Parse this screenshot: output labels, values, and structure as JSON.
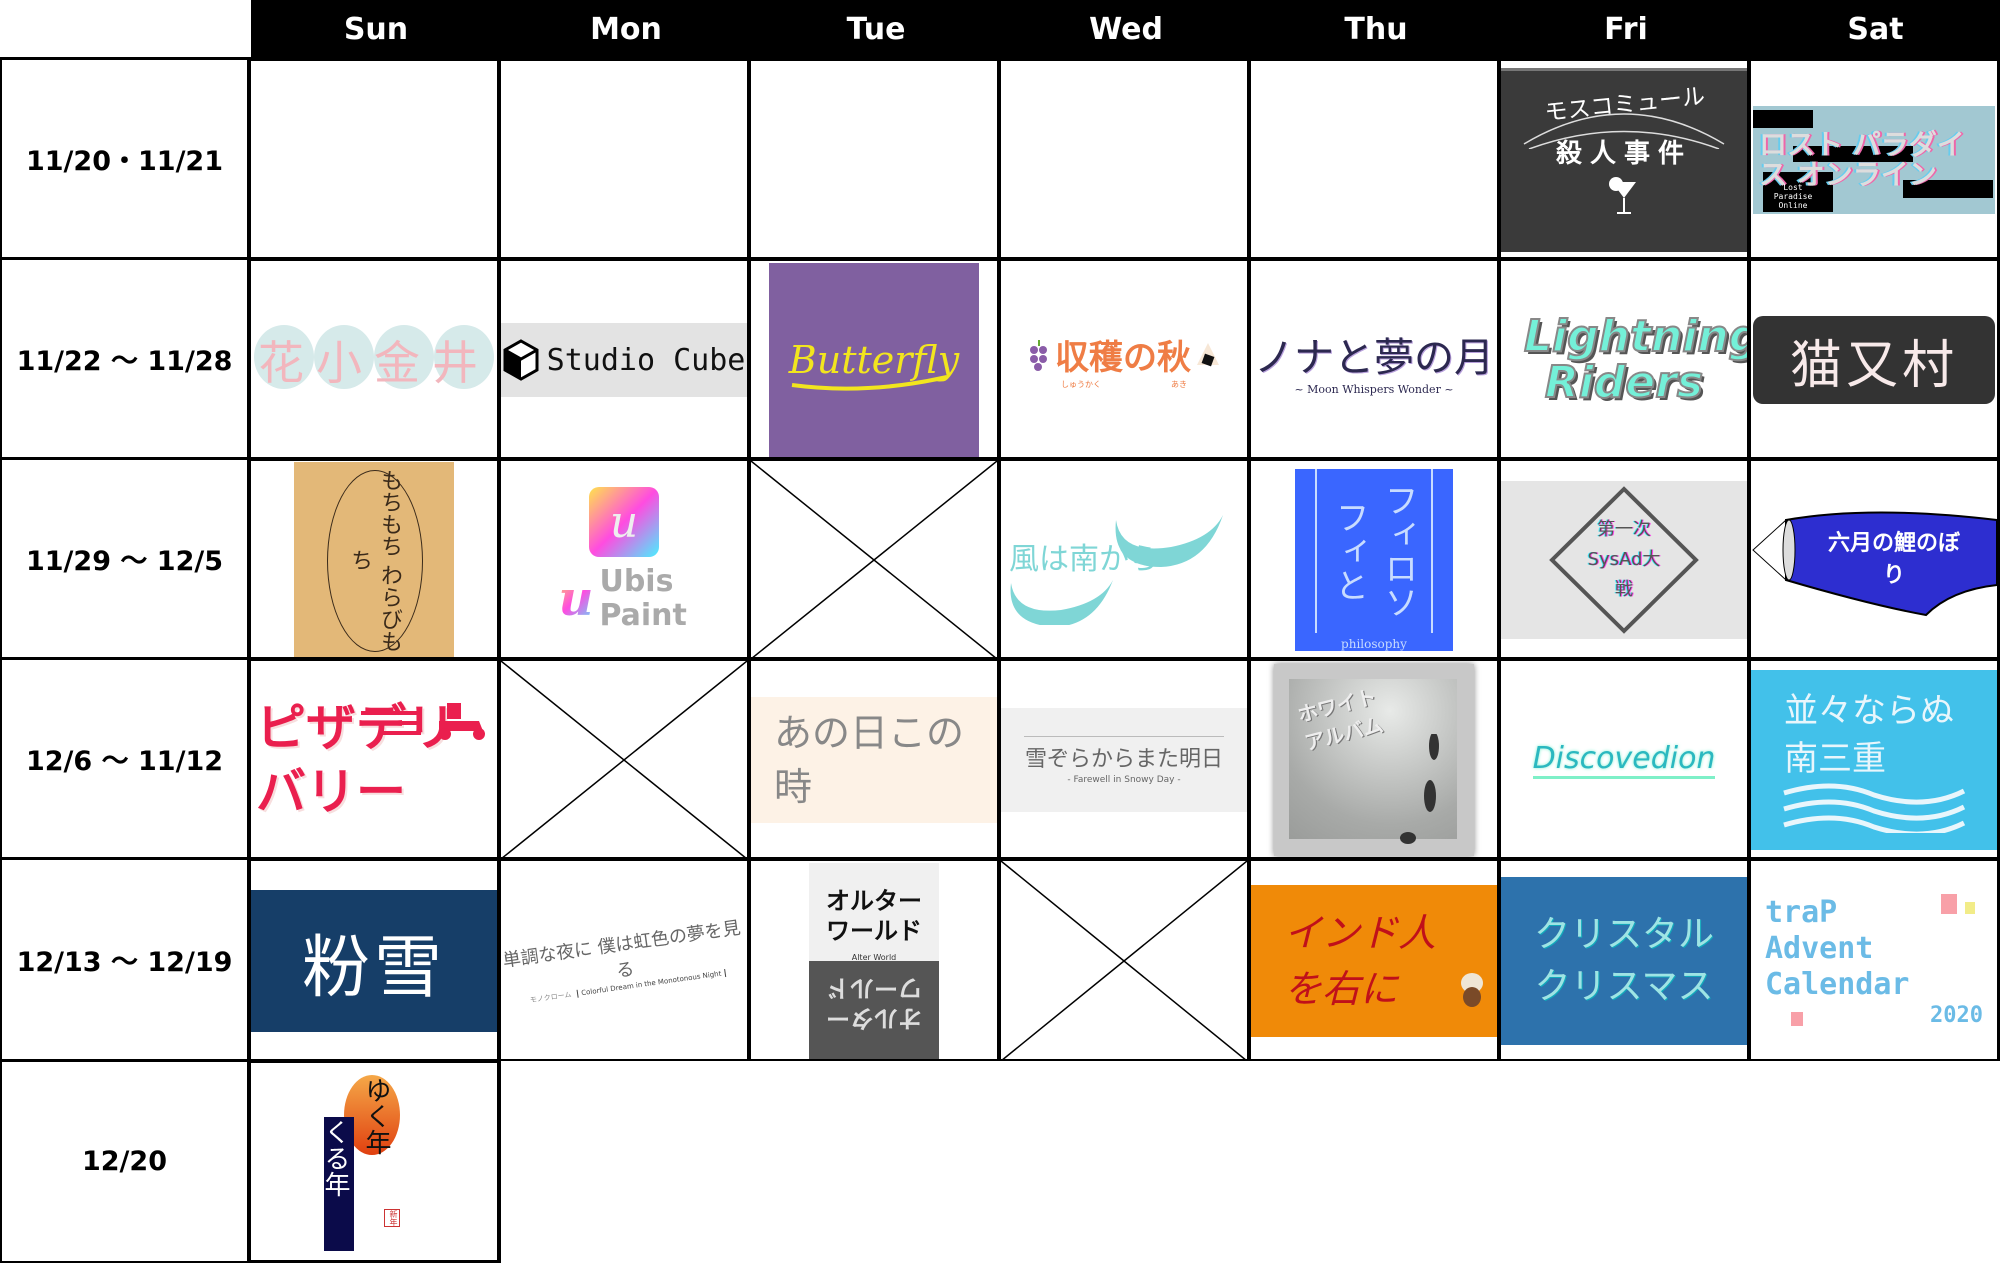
{
  "calendar": {
    "days": [
      "Sun",
      "Mon",
      "Tue",
      "Wed",
      "Thu",
      "Fri",
      "Sat"
    ],
    "weeks": [
      {
        "label": "11/20・11/21",
        "cells": [
          {
            "type": "empty"
          },
          {
            "type": "empty"
          },
          {
            "type": "empty"
          },
          {
            "type": "empty"
          },
          {
            "type": "empty"
          },
          {
            "type": "logo",
            "title": "モスコミュール",
            "subtitle": "殺人事件",
            "icon": "cocktail-glass-icon",
            "bg": "#3a3a3a",
            "fg": "#ffffff"
          },
          {
            "type": "logo",
            "title": "ロスト パラダイス オンライン",
            "subtitle": "Lost Paradise Online",
            "bg": "#a2c8d2",
            "fg": "#dddddd"
          }
        ]
      },
      {
        "label": "11/22 〜 11/28",
        "cells": [
          {
            "type": "logo",
            "title": "花小金井",
            "bg": "#d6eaea",
            "fg": "#f2b6bd"
          },
          {
            "type": "logo",
            "title": "Studio Cube",
            "icon": "cube-icon",
            "bg": "#e3e3e3",
            "fg": "#111111"
          },
          {
            "type": "logo",
            "title": "Butterfly",
            "bg": "#8060a0",
            "fg": "#f2e51e"
          },
          {
            "type": "logo",
            "title": "収穫の秋",
            "ruby": [
              "しゅうかく",
              "あき"
            ],
            "icon": "grapes-icon",
            "bg": "#ffffff",
            "fg": "#ef7d45"
          },
          {
            "type": "logo",
            "title": "ノナと夢の月",
            "subtitle": "~ Moon Whispers Wonder ~",
            "bg": "#ffffff",
            "fg": "#2c2850"
          },
          {
            "type": "logo",
            "title": "Lightning Riders",
            "bg": "#ffffff",
            "fg": "#74f0d8"
          },
          {
            "type": "logo",
            "title": "猫又村",
            "bg": "#333333",
            "fg": "#f8eaea"
          }
        ]
      },
      {
        "label": "11/29 〜 12/5",
        "cells": [
          {
            "type": "logo",
            "title": "もちもち わらびもち",
            "bg": "#e3b878",
            "fg": "#3a2a1a"
          },
          {
            "type": "logo",
            "title": "Ubis Paint",
            "icon": "ubis-paint-app-icon",
            "bg": "#ffffff",
            "fg": "#aaaaaa"
          },
          {
            "type": "none"
          },
          {
            "type": "logo",
            "title": "風は南から",
            "bg": "#ffffff",
            "fg": "#7fd6d6"
          },
          {
            "type": "logo",
            "title": "フィロソフィと",
            "subtitle": "philosophy",
            "bg": "#3a66ff",
            "fg": "#c8dcff"
          },
          {
            "type": "logo",
            "title": "第一次SysAd大戦",
            "bg": "#e5e5e5",
            "fg": "#555555"
          },
          {
            "type": "logo",
            "title": "六月の鯉のぼり",
            "bg": "#2d2ed0",
            "fg": "#ffffff"
          }
        ]
      },
      {
        "label": "12/6 〜 11/12",
        "cells": [
          {
            "type": "logo",
            "title": "ピザデリバリー",
            "icon": "scooter-icon",
            "bg": "#ffffff",
            "fg": "#ea1f4e"
          },
          {
            "type": "none"
          },
          {
            "type": "logo",
            "title": "あの日この時",
            "bg": "#fdf2e6",
            "fg": "#888888"
          },
          {
            "type": "logo",
            "title": "雪ぞらからまた明日",
            "subtitle": "- Farewell in Snowy Day -",
            "bg": "#f0f0f0",
            "fg": "#666666"
          },
          {
            "type": "logo",
            "title": "ホワイトアルバム",
            "bg": "#b8bab8",
            "fg": "#eeeeee"
          },
          {
            "type": "logo",
            "title": "Discovedion",
            "bg": "#ffffff",
            "fg": "#2bb8c0"
          },
          {
            "type": "logo",
            "title": "並々ならぬ南三重",
            "bg": "#42c1ea",
            "fg": "#e8f6fc"
          }
        ]
      },
      {
        "label": "12/13 〜 12/19",
        "cells": [
          {
            "type": "logo",
            "title": "粉雪",
            "bg": "#163e68",
            "fg": "#ffffff"
          },
          {
            "type": "logo",
            "title": "単調な夜に 僕は虹色の夢を見る",
            "ruby": [
              "モノクローム"
            ],
            "subtitle": "Colorful Dream in the Monotonous Night",
            "bg": "#ffffff",
            "fg": "#666666"
          },
          {
            "type": "logo",
            "title": "オルターワールド",
            "subtitle": "Alter World",
            "bg": "#f0f0f0",
            "fg": "#111111"
          },
          {
            "type": "none"
          },
          {
            "type": "logo",
            "title": "インド人を右に",
            "bg": "#f08a08",
            "fg": "#c0101a"
          },
          {
            "type": "logo",
            "title": "クリスタルクリスマス",
            "bg": "#2d72ac",
            "fg": "#9ee4e4"
          },
          {
            "type": "logo",
            "title": "traP Advent Calendar",
            "subtitle": "2020",
            "bg": "#ffffff",
            "fg": "#6bbbe6"
          }
        ]
      },
      {
        "label": "12/20",
        "cells": [
          {
            "type": "logo",
            "title": "ゆく年くる年",
            "stamp": "新年",
            "bg": "#ffffff",
            "fg": "#0b0b4a"
          }
        ]
      }
    ]
  }
}
